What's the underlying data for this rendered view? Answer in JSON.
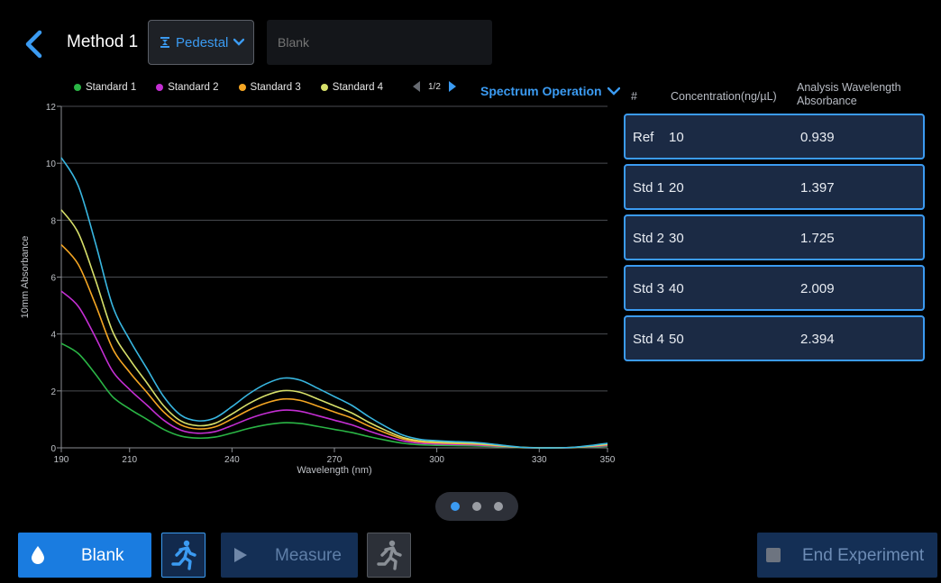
{
  "header": {
    "back_icon": "chevron-left-icon",
    "method_title": "Method 1",
    "pedestal_label": "Pedestal",
    "sample_placeholder": "Blank"
  },
  "legend": [
    {
      "label": "Standard 1",
      "color": "#2ab545"
    },
    {
      "label": "Standard 2",
      "color": "#c42ed3"
    },
    {
      "label": "Standard 3",
      "color": "#f5a623"
    },
    {
      "label": "Standard 4",
      "color": "#d7e06a"
    }
  ],
  "pager": {
    "text": "1/2"
  },
  "spectrum_operation_label": "Spectrum Operation",
  "chart_data": {
    "type": "line",
    "xlabel": "Wavelength (nm)",
    "ylabel": "10mm Absorbance",
    "xlim": [
      190,
      350
    ],
    "ylim": [
      0,
      12
    ],
    "x_ticks": [
      190,
      210,
      240,
      270,
      300,
      330,
      350
    ],
    "y_ticks": [
      0,
      2,
      4,
      6,
      8,
      10,
      12
    ],
    "grid": true,
    "legend_position": "top",
    "series": [
      {
        "name": "Standard 1",
        "color": "#2ab545",
        "scale": 0.36
      },
      {
        "name": "Standard 2",
        "color": "#c42ed3",
        "scale": 0.54
      },
      {
        "name": "Standard 3",
        "color": "#f5a623",
        "scale": 0.7
      },
      {
        "name": "Standard 4",
        "color": "#d7e06a",
        "scale": 0.82
      },
      {
        "name": "",
        "color": "#38b6e0",
        "scale": 1.0
      }
    ],
    "x": [
      190,
      195,
      200,
      205,
      210,
      215,
      220,
      225,
      230,
      235,
      240,
      245,
      250,
      255,
      260,
      265,
      270,
      275,
      280,
      285,
      290,
      295,
      300,
      305,
      310,
      315,
      320,
      325,
      330,
      335,
      340,
      345,
      350
    ],
    "base_values": [
      10.2,
      9.2,
      7.2,
      5.0,
      3.8,
      2.8,
      1.8,
      1.15,
      0.95,
      1.05,
      1.45,
      1.9,
      2.25,
      2.45,
      2.38,
      2.1,
      1.8,
      1.5,
      1.1,
      0.75,
      0.45,
      0.3,
      0.25,
      0.22,
      0.2,
      0.15,
      0.08,
      0.02,
      0.0,
      0.0,
      0.02,
      0.08,
      0.16
    ]
  },
  "table": {
    "headers": {
      "hash": "#",
      "concentration": "Concentration(ng/µL)",
      "absorbance_line1": "Analysis Wavelength",
      "absorbance_line2": "Absorbance"
    },
    "rows": [
      {
        "id": "Ref",
        "concentration": "10",
        "absorbance": "0.939"
      },
      {
        "id": "Std 1",
        "concentration": "20",
        "absorbance": "1.397"
      },
      {
        "id": "Std 2",
        "concentration": "30",
        "absorbance": "1.725"
      },
      {
        "id": "Std 3",
        "concentration": "40",
        "absorbance": "2.009"
      },
      {
        "id": "Std 4",
        "concentration": "50",
        "absorbance": "2.394"
      }
    ]
  },
  "pagination": {
    "count": 3,
    "active": 0
  },
  "footer": {
    "blank_label": "Blank",
    "measure_label": "Measure",
    "end_label": "End Experiment"
  }
}
